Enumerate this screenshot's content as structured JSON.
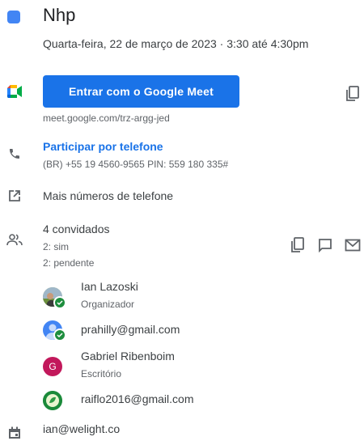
{
  "event": {
    "title": "Nhp",
    "date_time": "Quarta-feira, 22 de março de 2023  ·  3:30 até 4:30pm",
    "color": "#4285f4"
  },
  "meet": {
    "button_label": "Entrar com o Google Meet",
    "link": "meet.google.com/trz-argg-jed"
  },
  "phone": {
    "label": "Participar por telefone",
    "details": "(BR) +55 19 4560-9565 PIN: 559 180 335#"
  },
  "more_numbers": "Mais números de telefone",
  "guests": {
    "count_label": "4 convidados",
    "yes_label": "2: sim",
    "pending_label": "2: pendente",
    "list": [
      {
        "name": "Ian Lazoski",
        "role": "Organizador"
      },
      {
        "name": "prahilly@gmail.com",
        "role": ""
      },
      {
        "name": "Gabriel Ribenboim",
        "role": "Escritório",
        "initial": "G"
      },
      {
        "name": "raiflo2016@gmail.com",
        "role": ""
      }
    ]
  },
  "calendar_owner": "ian@welight.co"
}
